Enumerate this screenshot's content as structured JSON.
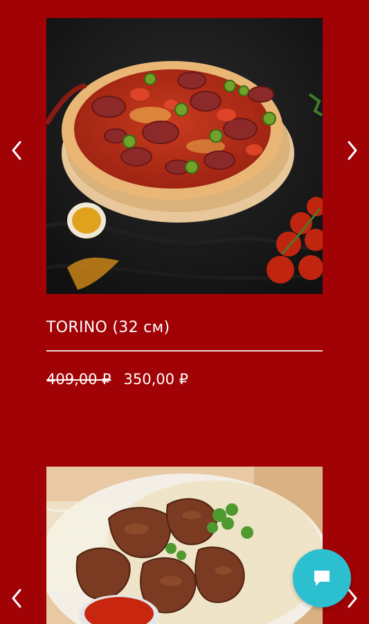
{
  "products": [
    {
      "name": "TORINO (32 см)",
      "old_price": "409,00 ₽",
      "price": "350,00 ₽",
      "image": "pizza-photo"
    },
    {
      "image": "shashlik-photo"
    }
  ],
  "carousel": {
    "prev_icon": "chevron-left-icon",
    "next_icon": "chevron-right-icon"
  },
  "chat": {
    "icon": "chat-bubble-icon",
    "color": "#2bbfd0"
  },
  "colors": {
    "background": "#a00205",
    "text": "#ffffff"
  }
}
